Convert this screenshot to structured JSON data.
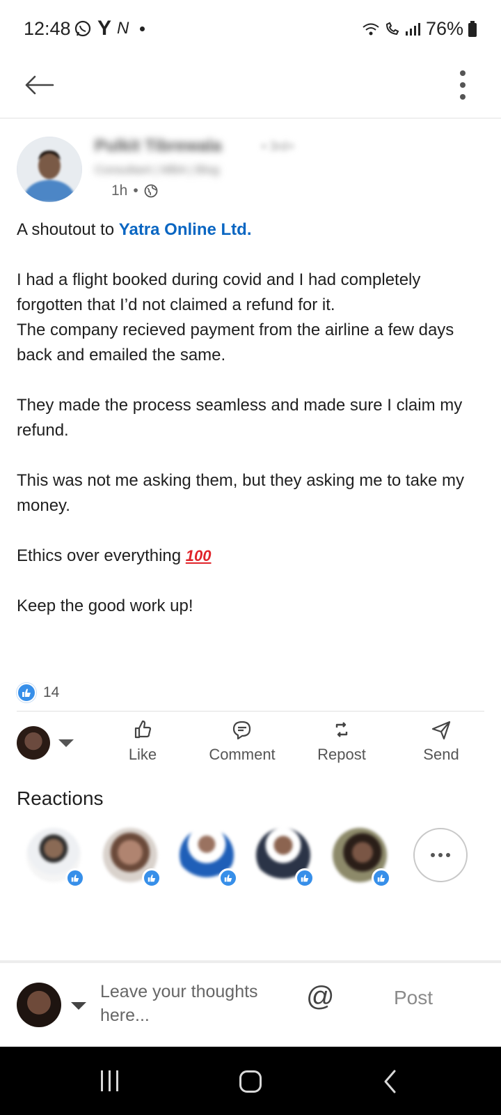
{
  "status_bar": {
    "time": "12:48",
    "app_y": "Y",
    "app_n": "N",
    "battery": "76%"
  },
  "author": {
    "name": "Pulkit Tibrewala",
    "degree": "• 3rd+",
    "headline": "Consultant | MBA | Blog",
    "time": "1h",
    "separator": "•"
  },
  "post": {
    "intro": "A shoutout to ",
    "mention": "Yatra Online Ltd.",
    "p1": "I had a flight booked during covid and I had completely forgotten that I’d not claimed a refund for it.",
    "p1b": "The company recieved payment from the airline a few days back and emailed the same.",
    "p2": "They made the process seamless and made sure I claim my refund.",
    "p3": "This was not me asking them, but they asking me to take my money.",
    "p4": "Ethics over everything ",
    "emoji": "100",
    "p5": "Keep the good work up!"
  },
  "reaction_count": "14",
  "actions": {
    "like": "Like",
    "comment": "Comment",
    "repost": "Repost",
    "send": "Send"
  },
  "reactions_title": "Reactions",
  "comment_box": {
    "placeholder": "Leave your thoughts here...",
    "at": "@",
    "post": "Post"
  },
  "colors": {
    "link": "#0a66c2",
    "like_badge": "#378fe9"
  }
}
